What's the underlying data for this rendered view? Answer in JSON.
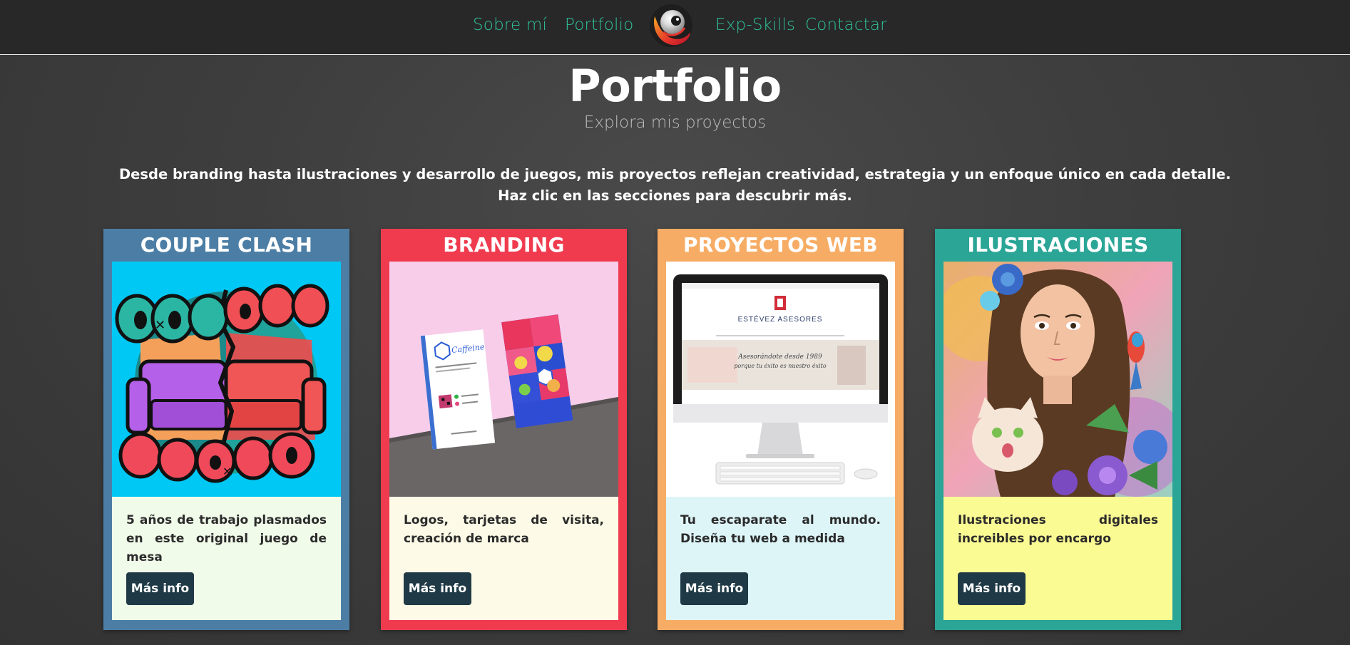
{
  "nav": {
    "items": [
      "Sobre mí",
      "Portfolio",
      "Exp-Skills",
      "Contactar"
    ],
    "link_color": "#2fc29a"
  },
  "header": {
    "title": "Portfolio",
    "subtitle": "Explora mis proyectos"
  },
  "intro": {
    "line1": "Desde branding hasta ilustraciones y desarrollo de juegos, mis proyectos reflejan creatividad, estrategia y un enfoque único en cada detalle.",
    "line2": "Haz clic en las secciones para descubrir más."
  },
  "cards": [
    {
      "title": "COUPLE CLASH",
      "description": "5 años de trabajo plasmados en este original juego de mesa",
      "button": "Más info",
      "frame_color": "#4c7ea5",
      "body_color": "#f1fbea",
      "image_icon": "couple-clash-artwork"
    },
    {
      "title": "BRANDING",
      "description": "Logos, tarjetas de visita, creación de marca",
      "button": "Más info",
      "frame_color": "#f03b4f",
      "body_color": "#fdfbe7",
      "image_icon": "business-cards-mockup",
      "image_text": {
        "brand": "Caffeine"
      }
    },
    {
      "title": "PROYECTOS WEB",
      "description": "Tu escaparate al mundo. Diseña tu web a medida",
      "button": "Más info",
      "frame_color": "#f7ac65",
      "body_color": "#def5f8",
      "image_icon": "desktop-computer-mockup",
      "image_text": {
        "site_name": "ESTÉVEZ ASESORES",
        "tagline_1": "Asesorándote desde 1989",
        "tagline_2": "porque tu éxito es nuestro éxito"
      }
    },
    {
      "title": "ILUSTRACIONES",
      "description": "Ilustraciones digitales increibles por encargo",
      "button": "Más info",
      "frame_color": "#2aa596",
      "body_color": "#fbfb94",
      "image_icon": "portrait-illustration"
    }
  ]
}
